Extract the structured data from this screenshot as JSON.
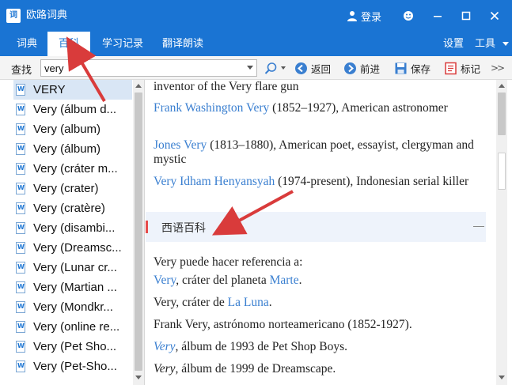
{
  "window": {
    "icon_text": "词",
    "title": "欧路词典",
    "login_label": "登录"
  },
  "tabs": [
    {
      "label": "词典",
      "active": false
    },
    {
      "label": "百科",
      "active": true
    },
    {
      "label": "学习记录",
      "active": false
    },
    {
      "label": "翻译朗读",
      "active": false
    }
  ],
  "menu": {
    "settings": "设置",
    "tools": "工具"
  },
  "toolbar": {
    "search_label": "查找",
    "search_value": "very",
    "back_label": "返回",
    "forward_label": "前进",
    "save_label": "保存",
    "mark_label": "标记",
    "more_label": ">>"
  },
  "list": {
    "items": [
      {
        "label": "VERY",
        "selected": true
      },
      {
        "label": "Very (álbum d...",
        "selected": false
      },
      {
        "label": "Very (album)",
        "selected": false
      },
      {
        "label": "Very (álbum)",
        "selected": false
      },
      {
        "label": "Very (cráter m...",
        "selected": false
      },
      {
        "label": "Very (crater)",
        "selected": false
      },
      {
        "label": "Very (cratère)",
        "selected": false
      },
      {
        "label": "Very (disambi...",
        "selected": false
      },
      {
        "label": "Very (Dreamsc...",
        "selected": false
      },
      {
        "label": "Very (Lunar cr...",
        "selected": false
      },
      {
        "label": "Very (Martian ...",
        "selected": false
      },
      {
        "label": "Very (Mondkr...",
        "selected": false
      },
      {
        "label": "Very (online re...",
        "selected": false
      },
      {
        "label": "Very (Pet Sho...",
        "selected": false
      },
      {
        "label": "Very (Pet-Sho...",
        "selected": false
      }
    ]
  },
  "content": {
    "line1": "inventor of the Very flare gun",
    "entry1": {
      "link": "Frank Washington Very",
      "text": " (1852–1927), American astronomer"
    },
    "entry2": {
      "link": "Jones Very",
      "text": " (1813–1880), American poet, essayist, clergyman and mystic"
    },
    "entry3": {
      "link": "Very Idham Henyansyah",
      "text": " (1974-present), Indonesian serial killer"
    },
    "section_title": "西语百科",
    "es_intro": "Very puede hacer referencia a:",
    "es_line1": {
      "link": "Very",
      "mid": ", cráter del planeta ",
      "link2": "Marte",
      "end": "."
    },
    "es_line2": {
      "text": "Very, cráter de ",
      "link": "La Luna",
      "end": "."
    },
    "es_line3": "Frank Very, astrónomo norteamericano (1852-1927).",
    "es_line4": {
      "link": "Very",
      "text": ", álbum de 1993 de Pet Shop Boys."
    },
    "es_line5": {
      "italic": "Very",
      "text": ", álbum de 1999 de Dreamscape."
    }
  },
  "colors": {
    "titlebar": "#1a74d3",
    "link": "#3a7fd0",
    "annotation_arrow": "#d93b3b",
    "section_marker": "#e64b4b"
  }
}
